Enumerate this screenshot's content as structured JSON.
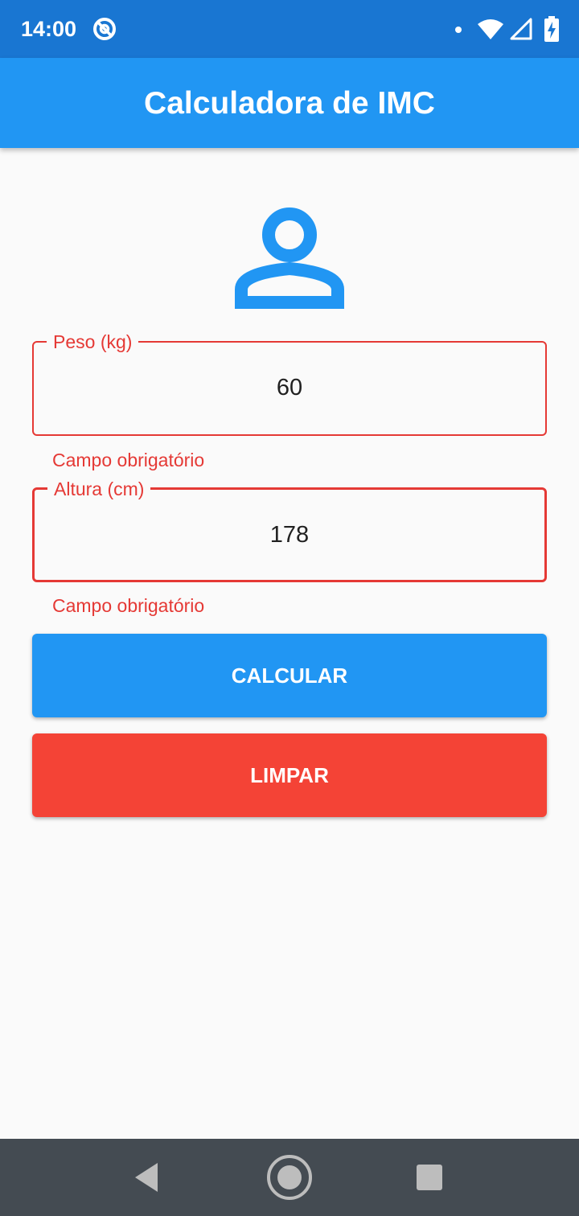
{
  "status_bar": {
    "time": "14:00",
    "icons": [
      "at-sign-icon",
      "notification-dot-icon",
      "wifi-icon",
      "cell-signal-icon",
      "battery-charging-icon"
    ]
  },
  "app_bar": {
    "title": "Calculadora de IMC"
  },
  "header_icon": "person-outline-icon",
  "form": {
    "peso": {
      "label": "Peso (kg)",
      "value": "60",
      "error": "Campo obrigatório"
    },
    "altura": {
      "label": "Altura (cm)",
      "value": "178",
      "error": "Campo obrigatório"
    }
  },
  "buttons": {
    "calcular": "CALCULAR",
    "limpar": "LIMPAR"
  },
  "nav_bar": {
    "icons": [
      "back-icon",
      "home-icon",
      "recents-icon"
    ]
  },
  "colors": {
    "status_bar": "#1976d2",
    "primary": "#2196f3",
    "error": "#e53935",
    "danger_button": "#f44336",
    "background": "#fafafa",
    "nav_bar": "#444b52"
  }
}
